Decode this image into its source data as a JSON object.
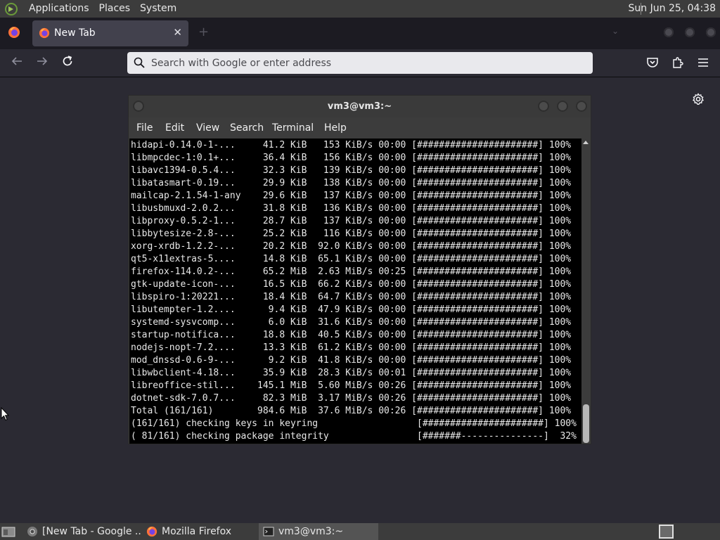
{
  "top_panel": {
    "menus": [
      "Applications",
      "Places",
      "System"
    ],
    "clock": "Sun Jun 25, 04:38"
  },
  "browser": {
    "tab": {
      "title": "New Tab",
      "close": "✕"
    },
    "new_tab": "+",
    "list_all_tabs": "⌄",
    "urlbar": {
      "placeholder": "Search with Google or enter address"
    }
  },
  "terminal": {
    "title": "vm3@vm3:~",
    "menu": [
      "File",
      "Edit",
      "View",
      "Search",
      "Terminal",
      "Help"
    ],
    "lines": [
      "hidapi-0.14.0-1-...     41.2 KiB   153 KiB/s 00:00 [######################] 100%",
      "libmpcdec-1:0.1+...     36.4 KiB   156 KiB/s 00:00 [######################] 100%",
      "libavc1394-0.5.4...     32.3 KiB   139 KiB/s 00:00 [######################] 100%",
      "libatasmart-0.19...     29.9 KiB   138 KiB/s 00:00 [######################] 100%",
      "mailcap-2.1.54-1-any    29.6 KiB   137 KiB/s 00:00 [######################] 100%",
      "libusbmuxd-2.0.2...     31.8 KiB   136 KiB/s 00:00 [######################] 100%",
      "libproxy-0.5.2-1...     28.7 KiB   137 KiB/s 00:00 [######################] 100%",
      "libbytesize-2.8-...     25.2 KiB   116 KiB/s 00:00 [######################] 100%",
      "xorg-xrdb-1.2.2-...     20.2 KiB  92.0 KiB/s 00:00 [######################] 100%",
      "qt5-x11extras-5....     14.8 KiB  65.1 KiB/s 00:00 [######################] 100%",
      "firefox-114.0.2-...     65.2 MiB  2.63 MiB/s 00:25 [######################] 100%",
      "gtk-update-icon-...     16.5 KiB  66.2 KiB/s 00:00 [######################] 100%",
      "libspiro-1:20221...     18.4 KiB  64.7 KiB/s 00:00 [######################] 100%",
      "libutempter-1.2....      9.4 KiB  47.9 KiB/s 00:00 [######################] 100%",
      "systemd-sysvcomp...      6.0 KiB  31.6 KiB/s 00:00 [######################] 100%",
      "startup-notifica...     18.8 KiB  40.5 KiB/s 00:00 [######################] 100%",
      "nodejs-nopt-7.2....     13.3 KiB  61.2 KiB/s 00:00 [######################] 100%",
      "mod_dnssd-0.6-9-...      9.2 KiB  41.8 KiB/s 00:00 [######################] 100%",
      "libwbclient-4.18...     35.9 KiB  28.3 KiB/s 00:01 [######################] 100%",
      "libreoffice-stil...    145.1 MiB  5.60 MiB/s 00:26 [######################] 100%",
      "dotnet-sdk-7.0.7...     82.3 MiB  3.17 MiB/s 00:26 [######################] 100%",
      "Total (161/161)        984.6 MiB  37.6 MiB/s 00:26 [######################] 100%",
      "(161/161) checking keys in keyring                  [######################] 100%",
      "( 81/161) checking package integrity                [#######---------------]  32%"
    ]
  },
  "taskbar": {
    "tasks": [
      "[New Tab - Google ...",
      "Mozilla Firefox",
      "vm3@vm3:~"
    ]
  }
}
